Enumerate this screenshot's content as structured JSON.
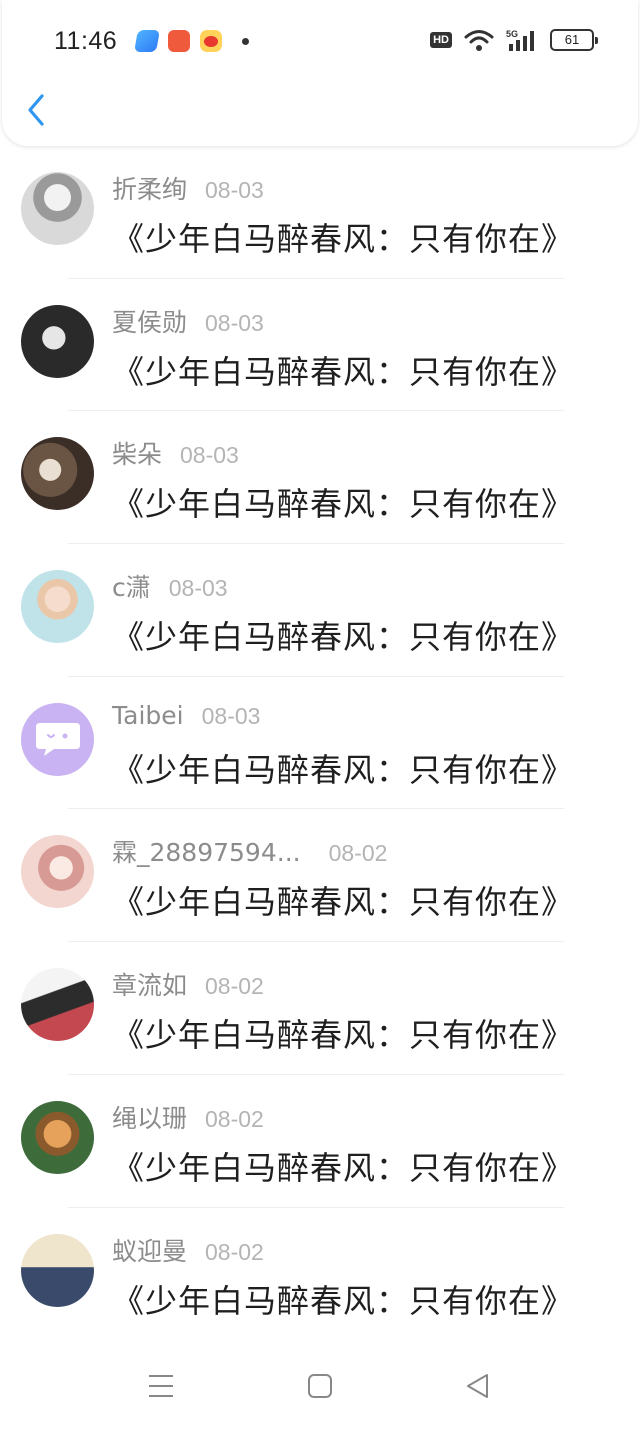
{
  "status_bar": {
    "time": "11:46",
    "network": "5G",
    "battery": "61",
    "hd_label": "HD",
    "app_icons": [
      "tencent-video-icon",
      "taobao-app-icon",
      "weibo-icon"
    ]
  },
  "nav": {
    "back_icon": "chevron-left-icon",
    "accent_color": "#2f96f0"
  },
  "comments": [
    {
      "name": "折柔绚",
      "date": "08-03",
      "message": "《少年白马醉春风：只有你在》",
      "avatar_colors": [
        "#d9d9d9",
        "#555555"
      ]
    },
    {
      "name": "夏侯勋",
      "date": "08-03",
      "message": "《少年白马醉春风：只有你在》",
      "avatar_colors": [
        "#2a2a2a",
        "#e6e6e6"
      ]
    },
    {
      "name": "柴朵",
      "date": "08-03",
      "message": "《少年白马醉春风：只有你在》",
      "avatar_colors": [
        "#5a4a3c",
        "#c9b9a5"
      ]
    },
    {
      "name": "c潇",
      "date": "08-03",
      "message": "《少年白马醉春风：只有你在》",
      "avatar_colors": [
        "#bfe3e8",
        "#f4d9c9"
      ]
    },
    {
      "name": "Taibei",
      "date": "08-03",
      "message": "《少年白马醉春风：只有你在》",
      "avatar_colors": [
        "#c9b3f2",
        "#ffffff"
      ]
    },
    {
      "name": "霖_28897594...",
      "date": "08-02",
      "message": "《少年白马醉春风：只有你在》",
      "avatar_colors": [
        "#f3d6d0",
        "#d89a94"
      ]
    },
    {
      "name": "章流如",
      "date": "08-02",
      "message": "《少年白马醉春风：只有你在》",
      "avatar_colors": [
        "#3a3a3a",
        "#c44850"
      ]
    },
    {
      "name": "绳以珊",
      "date": "08-02",
      "message": "《少年白马醉春风：只有你在》",
      "avatar_colors": [
        "#d98a3c",
        "#3d6b3a"
      ]
    },
    {
      "name": "蚁迎曼",
      "date": "08-02",
      "message": "《少年白马醉春风：只有你在》",
      "avatar_colors": [
        "#e8d9b8",
        "#3a4a6a"
      ]
    }
  ],
  "bottom_nav": {
    "menu_icon": "menu-lines-icon",
    "home_icon": "square-home-icon",
    "back_icon": "triangle-back-icon"
  }
}
